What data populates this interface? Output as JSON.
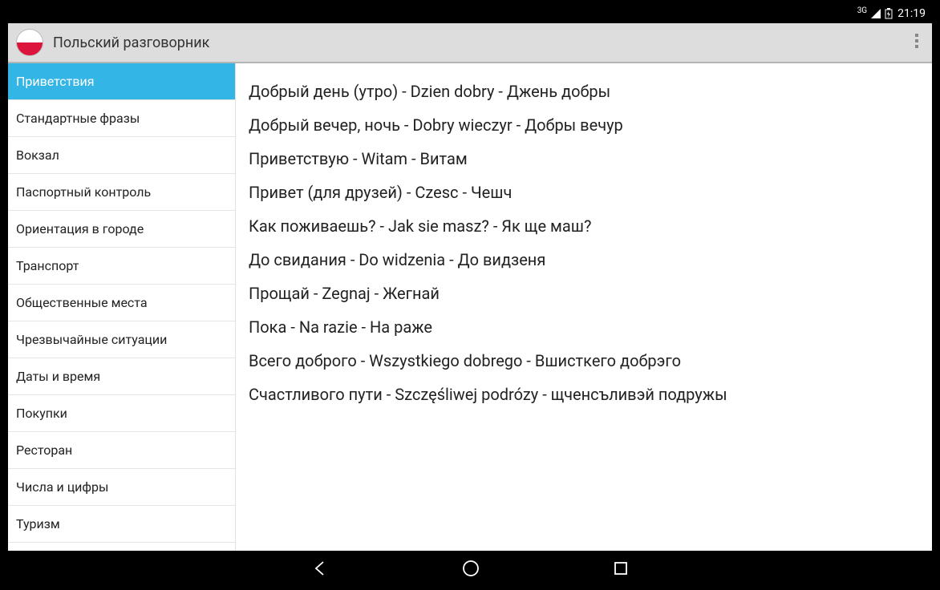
{
  "status": {
    "net": "3G",
    "time": "21:19"
  },
  "header": {
    "title": "Польский разговорник"
  },
  "sidebar": {
    "selectedIndex": 0,
    "items": [
      {
        "label": "Приветствия"
      },
      {
        "label": "Стандартные фразы"
      },
      {
        "label": "Вокзал"
      },
      {
        "label": "Паспортный контроль"
      },
      {
        "label": "Ориентация в городе"
      },
      {
        "label": "Транспорт"
      },
      {
        "label": "Общественные места"
      },
      {
        "label": "Чрезвычайные ситуации"
      },
      {
        "label": "Даты и время"
      },
      {
        "label": "Покупки"
      },
      {
        "label": "Ресторан"
      },
      {
        "label": "Числа и цифры"
      },
      {
        "label": "Туризм"
      }
    ]
  },
  "content": {
    "phrases": [
      {
        "text": "Добрый день (утро) - Dzien dobry - Джень добры"
      },
      {
        "text": "Добрый вечер, ночь - Dobry wieczyr - Добры вечур"
      },
      {
        "text": "Приветствую - Witam - Витам"
      },
      {
        "text": "Привет (для друзей) - Czesc - Чешч"
      },
      {
        "text": "Как поживаешь? - Jak sie masz? - Як ще маш?"
      },
      {
        "text": "До свидания - Do widzenia - До видзеня"
      },
      {
        "text": "Прощай - Zegnaj - Жегнай"
      },
      {
        "text": "Пока - Na razie - На раже"
      },
      {
        "text": "Всего доброго - Wszystkiego dobrego - Вшисткего добрэго"
      },
      {
        "text": "Счастливого пути - Szczęśliwej podrózy - щченсъливэй подружы"
      }
    ]
  }
}
